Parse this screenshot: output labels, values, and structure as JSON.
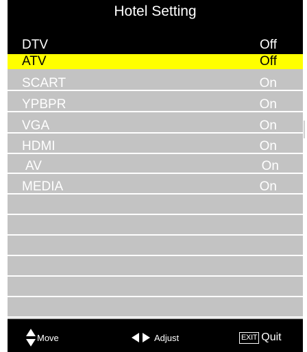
{
  "title": "Hotel Setting",
  "items": [
    {
      "label": "DTV",
      "value": "Off"
    },
    {
      "label": "ATV",
      "value": "Off"
    },
    {
      "label": "SCART",
      "value": "On"
    },
    {
      "label": "YPBPR",
      "value": "On"
    },
    {
      "label": "VGA",
      "value": "On"
    },
    {
      "label": "HDMI",
      "value": "On"
    },
    {
      "label": "AV",
      "value": "On"
    },
    {
      "label": "MEDIA",
      "value": "On"
    }
  ],
  "selected_item": "ATV",
  "footer": {
    "move_label": "Move",
    "adjust_label": "Adjust",
    "exit_key_label": "EXIT",
    "quit_label": "Quit"
  },
  "icons": {
    "move": "up-down-arrows-icon",
    "adjust": "left-right-arrows-icon"
  },
  "colors": {
    "background": "#000000",
    "list_background": "#c3c3c3",
    "highlight": "#ffff00",
    "text": "#ffffff"
  }
}
